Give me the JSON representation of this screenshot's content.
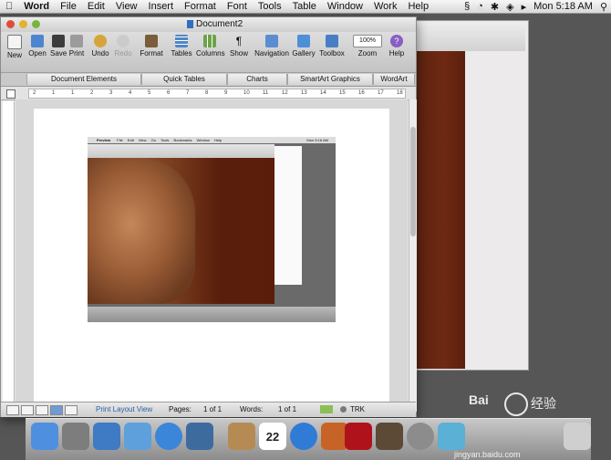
{
  "menubar": {
    "app": "Word",
    "items": [
      "File",
      "Edit",
      "View",
      "Insert",
      "Format",
      "Font",
      "Tools",
      "Table",
      "Window",
      "Work",
      "Help"
    ],
    "clock": "Mon 5:18 AM"
  },
  "window": {
    "title": "Document2"
  },
  "toolbar": {
    "buttons": [
      {
        "label": "New",
        "icon": "new-doc-icon"
      },
      {
        "label": "Open",
        "icon": "open-folder-icon"
      },
      {
        "label": "Save",
        "icon": "save-disk-icon"
      },
      {
        "label": "Print",
        "icon": "printer-icon"
      },
      {
        "label": "Undo",
        "icon": "undo-icon"
      },
      {
        "label": "Redo",
        "icon": "redo-icon"
      },
      {
        "label": "Format",
        "icon": "format-brush-icon"
      },
      {
        "label": "Tables",
        "icon": "table-grid-icon"
      },
      {
        "label": "Columns",
        "icon": "columns-icon"
      },
      {
        "label": "Show",
        "icon": "pilcrow-icon"
      },
      {
        "label": "Navigation",
        "icon": "navigation-pane-icon"
      },
      {
        "label": "Gallery",
        "icon": "gallery-icon"
      },
      {
        "label": "Toolbox",
        "icon": "toolbox-icon"
      },
      {
        "label": "Zoom",
        "icon": "zoom-dropdown-icon"
      },
      {
        "label": "Help",
        "icon": "help-icon"
      }
    ],
    "zoom_value": "100%"
  },
  "ribbon_tabs": [
    "Document Elements",
    "Quick Tables",
    "Charts",
    "SmartArt Graphics",
    "WordArt"
  ],
  "status": {
    "view": "Print Layout View",
    "pages_label": "Pages:",
    "pages_value": "1 of 1",
    "words_label": "Words:",
    "words_value": "1 of 1",
    "trk": "TRK"
  },
  "ruler_labels": [
    "2",
    "1",
    "1",
    "2",
    "3",
    "4",
    "5",
    "6",
    "7",
    "8",
    "9",
    "10",
    "11",
    "12",
    "13",
    "14",
    "15",
    "16",
    "17",
    "18"
  ],
  "embedded": {
    "menubar_items": [
      "Preview",
      "File",
      "Edit",
      "View",
      "Go",
      "Tools",
      "Bookmarks",
      "Window",
      "Help"
    ],
    "clock": "Mon 5:18 AM"
  },
  "dock_icons": [
    "finder-icon",
    "rocket-icon",
    "app-store-icon",
    "mail-icon",
    "safari-icon",
    "facetime-icon",
    "address-book-icon",
    "calendar-icon",
    "itunes-icon",
    "photo-booth-icon",
    "word-icon",
    "movie-icon",
    "preferences-icon",
    "sogou-icon",
    "trash-icon"
  ],
  "calendar_day": "22",
  "watermark": {
    "brand": "Bai",
    "cn": "经验",
    "url": "jingyan.baidu.com"
  }
}
